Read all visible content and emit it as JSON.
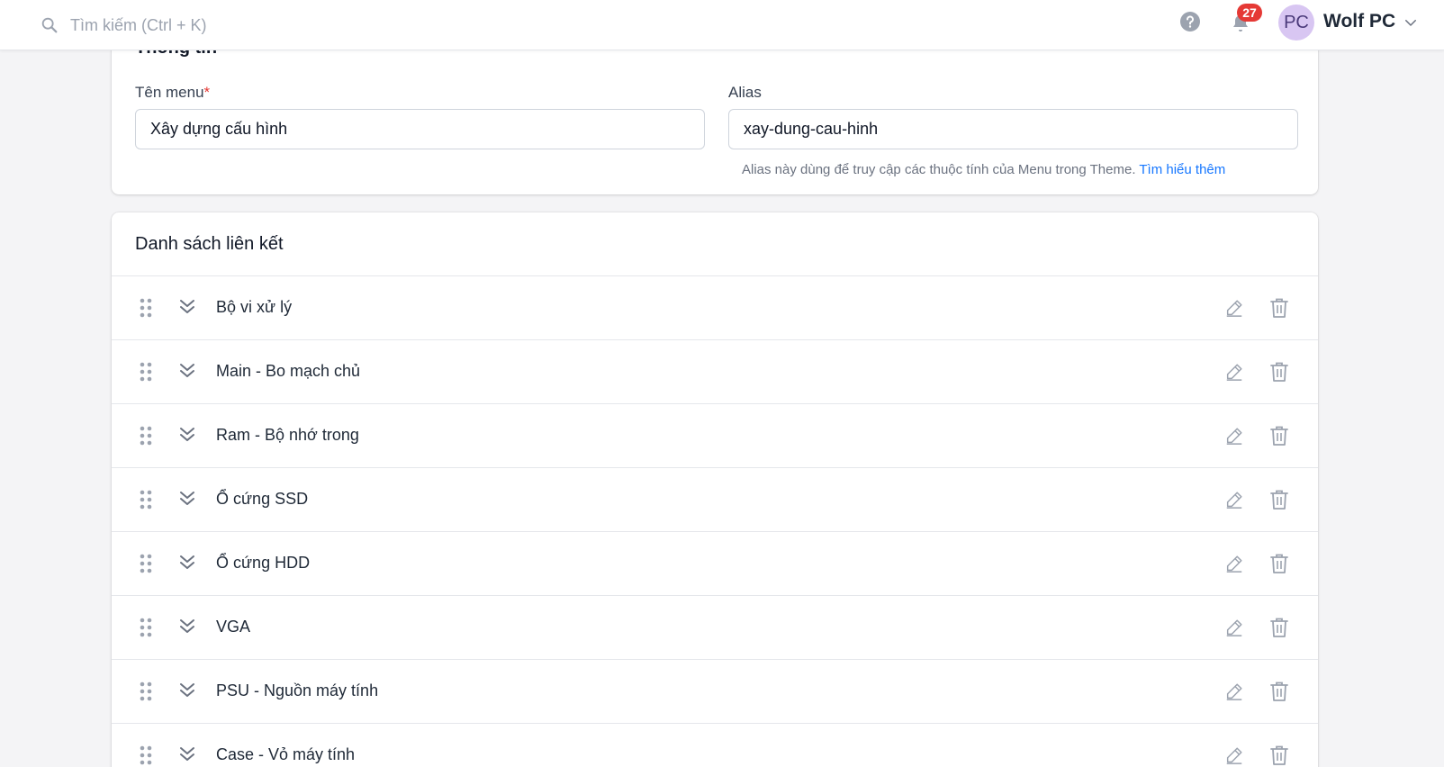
{
  "header": {
    "search_placeholder": "Tìm kiếm (Ctrl + K)",
    "notification_count": "27",
    "avatar_initials": "PC",
    "user_name": "Wolf PC"
  },
  "info_card": {
    "title": "Thông tin",
    "menu_name_label": "Tên menu",
    "menu_name_required": "*",
    "menu_name_value": "Xây dựng cấu hình",
    "alias_label": "Alias",
    "alias_value": "xay-dung-cau-hinh",
    "alias_hint": "Alias này dùng để truy cập các thuộc tính của Menu trong Theme.",
    "alias_hint_link": "Tìm hiểu thêm"
  },
  "links_card": {
    "title": "Danh sách liên kết",
    "items": [
      {
        "label": "Bộ vi xử lý"
      },
      {
        "label": "Main - Bo mạch chủ"
      },
      {
        "label": "Ram - Bộ nhớ trong"
      },
      {
        "label": "Ổ cứng SSD"
      },
      {
        "label": "Ổ cứng HDD"
      },
      {
        "label": "VGA"
      },
      {
        "label": "PSU - Nguồn máy tính"
      },
      {
        "label": "Case - Vỏ máy tính"
      }
    ]
  },
  "colors": {
    "accent_link": "#1677ff",
    "badge": "#e53935",
    "avatar_bg": "#d8c6f2"
  }
}
